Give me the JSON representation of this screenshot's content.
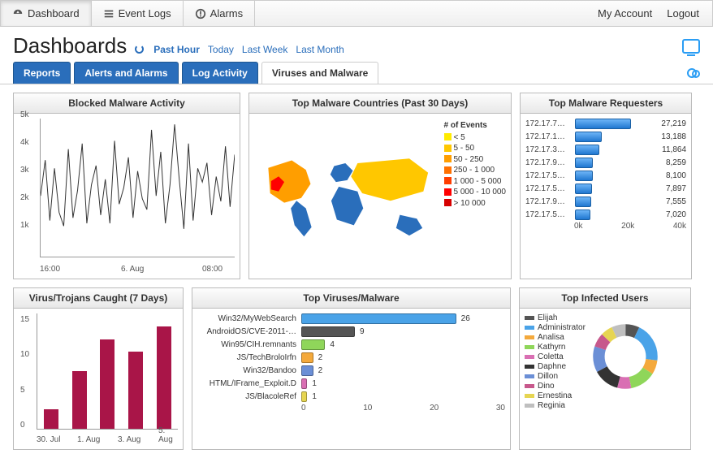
{
  "topnav": [
    {
      "label": "Dashboard",
      "active": true
    },
    {
      "label": "Event Logs",
      "active": false
    },
    {
      "label": "Alarms",
      "active": false
    }
  ],
  "rightlinks": {
    "account": "My Account",
    "logout": "Logout"
  },
  "title": "Dashboards",
  "time_filters": [
    "Past Hour",
    "Today",
    "Last Week",
    "Last Month"
  ],
  "time_active": "Past Hour",
  "tabs": [
    "Reports",
    "Alerts and Alarms",
    "Log Activity",
    "Viruses and Malware"
  ],
  "tab_active": "Viruses and Malware",
  "panels": {
    "blocked": {
      "title": "Blocked Malware Activity"
    },
    "map": {
      "title": "Top Malware Countries (Past 30 Days)",
      "legend_title": "# of Events",
      "legend": [
        {
          "label": "< 5",
          "color": "#ffeb00"
        },
        {
          "label": "5 - 50",
          "color": "#ffc700"
        },
        {
          "label": "50 - 250",
          "color": "#ff9e00"
        },
        {
          "label": "250 - 1 000",
          "color": "#ff7000"
        },
        {
          "label": "1 000 - 5 000",
          "color": "#ff3d00"
        },
        {
          "label": "5 000 - 10 000",
          "color": "#ff0000"
        },
        {
          "label": "> 10 000",
          "color": "#d60000"
        }
      ]
    },
    "requesters": {
      "title": "Top Malware Requesters",
      "axis": [
        "0k",
        "20k",
        "40k"
      ]
    },
    "caught": {
      "title": "Virus/Trojans Caught (7 Days)"
    },
    "topvm": {
      "title": "Top Viruses/Malware",
      "axis": [
        "0",
        "10",
        "20",
        "30"
      ]
    },
    "infected": {
      "title": "Top Infected Users"
    }
  },
  "chart_data": {
    "blocked": {
      "type": "line",
      "ylim": [
        0,
        5000
      ],
      "yticks": [
        "1k",
        "2k",
        "3k",
        "4k",
        "5k"
      ],
      "xticks": [
        "16:00",
        "6. Aug",
        "08:00"
      ],
      "values": [
        2200,
        3500,
        1300,
        3200,
        1600,
        1100,
        3900,
        1400,
        2400,
        4100,
        1200,
        2600,
        3300,
        1500,
        2800,
        1200,
        4200,
        1900,
        2500,
        3600,
        1400,
        3100,
        2100,
        1700,
        4600,
        2200,
        3800,
        1200,
        2600,
        4800,
        2800,
        1000,
        4100,
        1300,
        3200,
        2700,
        3400,
        1500,
        2900,
        2000,
        4000,
        1800,
        3700
      ]
    },
    "requesters": {
      "type": "bar",
      "max": 40000,
      "items": [
        {
          "label": "172.17.7…",
          "value": 27219
        },
        {
          "label": "172.17.1…",
          "value": 13188
        },
        {
          "label": "172.17.3…",
          "value": 11864
        },
        {
          "label": "172.17.9…",
          "value": 8259
        },
        {
          "label": "172.17.5…",
          "value": 8100
        },
        {
          "label": "172.17.5…",
          "value": 7897
        },
        {
          "label": "172.17.9…",
          "value": 7555
        },
        {
          "label": "172.17.5…",
          "value": 7020
        }
      ]
    },
    "caught": {
      "type": "bar",
      "ylim": [
        0,
        18
      ],
      "yticks": [
        "0",
        "5",
        "10",
        "15"
      ],
      "xticks": [
        "30. Jul",
        "1. Aug",
        "3. Aug",
        "5. Aug"
      ],
      "values": [
        3,
        9,
        14,
        12,
        16
      ]
    },
    "topvm": {
      "type": "bar",
      "max": 30,
      "items": [
        {
          "label": "Win32/MyWebSearch",
          "value": 26,
          "color": "#4aa3e8"
        },
        {
          "label": "AndroidOS/CVE-2011-…",
          "value": 9,
          "color": "#555555"
        },
        {
          "label": "Win95/CIH.remnants",
          "value": 4,
          "color": "#8fd65a"
        },
        {
          "label": "JS/TechBroloIrfn",
          "value": 2,
          "color": "#f4a93c"
        },
        {
          "label": "Win32/Bandoo",
          "value": 2,
          "color": "#6b8fd6"
        },
        {
          "label": "HTML/IFrame_Exploit.D",
          "value": 1,
          "color": "#d96fb3"
        },
        {
          "label": "JS/BlacoleRef",
          "value": 1,
          "color": "#e6d552"
        }
      ]
    },
    "infected": {
      "type": "pie",
      "users": [
        {
          "name": "Elijah",
          "color": "#555555",
          "value": 7
        },
        {
          "name": "Administrator",
          "color": "#4aa3e8",
          "value": 20
        },
        {
          "name": "Analisa",
          "color": "#f4a93c",
          "value": 7
        },
        {
          "name": "Kathyrn",
          "color": "#8fd65a",
          "value": 13
        },
        {
          "name": "Coletta",
          "color": "#d96fb3",
          "value": 7
        },
        {
          "name": "Daphne",
          "color": "#333333",
          "value": 13
        },
        {
          "name": "Dillon",
          "color": "#6b8fd6",
          "value": 13
        },
        {
          "name": "Dino",
          "color": "#c7588c",
          "value": 7
        },
        {
          "name": "Ernestina",
          "color": "#e6d552",
          "value": 6
        },
        {
          "name": "Reginia",
          "color": "#bfbfbf",
          "value": 7
        }
      ]
    }
  }
}
